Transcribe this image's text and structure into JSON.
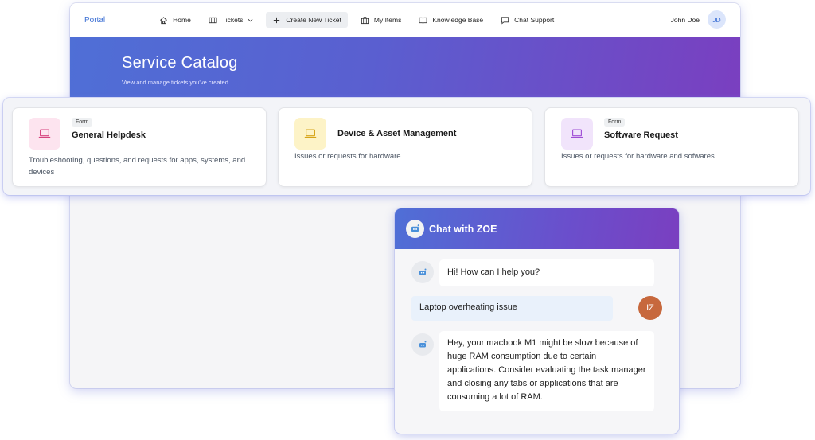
{
  "nav": {
    "brand": "Portal",
    "items": [
      {
        "label": "Home",
        "icon": "home-icon"
      },
      {
        "label": "Tickets",
        "icon": "ticket-icon",
        "dropdown": true
      },
      {
        "label": "Create New Ticket",
        "icon": "plus-icon",
        "active": true
      },
      {
        "label": "My Items",
        "icon": "briefcase-icon"
      },
      {
        "label": "Knowledge Base",
        "icon": "book-icon"
      },
      {
        "label": "Chat Support",
        "icon": "chat-icon"
      }
    ],
    "user_name": "John Doe",
    "user_initials": "JD"
  },
  "hero": {
    "title": "Service Catalog",
    "subtitle": "View and manage tickets you've created"
  },
  "cards": [
    {
      "badge": "Form",
      "title": "General Helpdesk",
      "description": "Troubleshooting, questions, and requests for apps, systems, and devices",
      "icon": "laptop-icon",
      "icon_bg": "#fde4ef",
      "icon_color": "#d6437f"
    },
    {
      "badge": "",
      "title": "Device & Asset Management",
      "description": "Issues or requests for hardware",
      "icon": "laptop-icon",
      "icon_bg": "#fdf3c7",
      "icon_color": "#d6a418"
    },
    {
      "badge": "Form",
      "title": "Software Request",
      "description": "Issues or requests for hardware and sofwares",
      "icon": "laptop-icon",
      "icon_bg": "#f1e4fb",
      "icon_color": "#a04fd6"
    }
  ],
  "chat": {
    "title": "Chat with ZOE",
    "messages": [
      {
        "from": "bot",
        "text": "Hi! How can I help you?"
      },
      {
        "from": "user",
        "text": "Laptop overheating issue",
        "initials": "IZ"
      },
      {
        "from": "bot",
        "text": "Hey, your macbook M1 might be slow because of huge RAM consumption due to certain applications. Consider evaluating the task manager and closing any tabs or applications that are consuming a lot of RAM."
      }
    ]
  }
}
